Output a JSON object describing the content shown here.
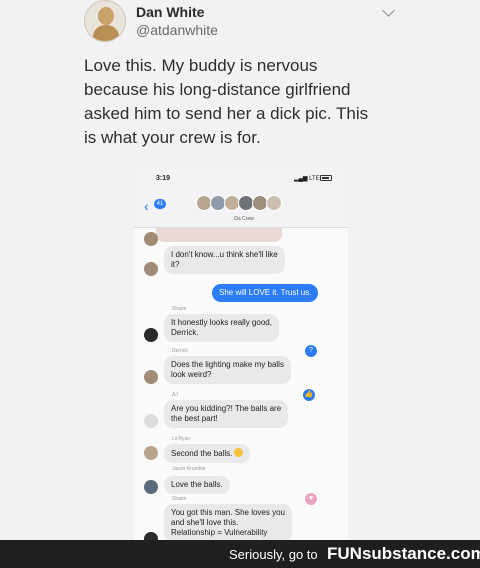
{
  "tweet": {
    "name": "Dan White",
    "handle": "@atdanwhite",
    "text_lines": [
      "Love this. My buddy is nervous",
      "because his long-distance girlfriend",
      "asked him to send her a dick pic. This",
      "is what your crew is for."
    ]
  },
  "phone": {
    "time": "3:19",
    "signal": "LTE",
    "back_count": "41",
    "group_name": "Da Crew",
    "messages": [
      {
        "sender": "",
        "lines": [
          "I don't know...u think she'll like",
          "it?"
        ],
        "direction": "in"
      },
      {
        "sender": "",
        "lines": [
          "She will LOVE it. Trust us."
        ],
        "direction": "out"
      },
      {
        "sender": "Shane",
        "lines": [
          "It honestly looks really good,",
          "Derrick."
        ],
        "direction": "in"
      },
      {
        "sender": "Derrick",
        "lines": [
          "Does the lighting make my balls",
          "look weird?"
        ],
        "direction": "in",
        "tapback": "question"
      },
      {
        "sender": "AJ",
        "lines": [
          "Are you kidding?! The balls are",
          "the best part!"
        ],
        "direction": "in",
        "tapback": "thumbs-up"
      },
      {
        "sender": "Lil Ryan",
        "lines": [
          "Second the balls."
        ],
        "direction": "in"
      },
      {
        "sender": "Jason Krumble",
        "lines": [
          "Love the balls."
        ],
        "direction": "in"
      },
      {
        "sender": "Shane",
        "lines": [
          "You got this man. She loves you",
          "and she'll love this.",
          "Relationship = Vulnerability"
        ],
        "direction": "in",
        "tapback": "heart"
      }
    ]
  },
  "footer": {
    "text": "Seriously, go to",
    "brand": "FUNsubstance.com"
  },
  "colors": {
    "imessage_blue": "#2b7cf6",
    "incoming_bubble": "#e9e9eb",
    "footer_bg": "#1f1f1f"
  }
}
